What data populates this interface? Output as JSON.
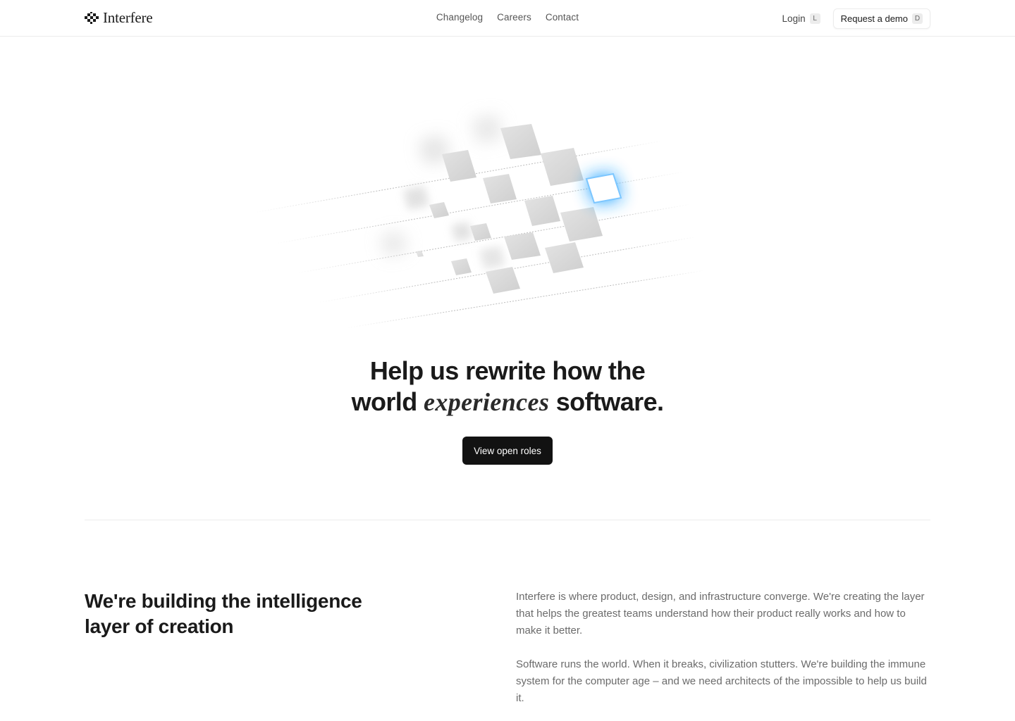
{
  "brand": {
    "name": "Interfere"
  },
  "nav": {
    "links": [
      "Changelog",
      "Careers",
      "Contact"
    ],
    "login_label": "Login",
    "login_key": "L",
    "demo_label": "Request a demo",
    "demo_key": "D"
  },
  "hero": {
    "title_line1": "Help us rewrite how the",
    "title_line2_before": "world",
    "title_accent": "experiences",
    "title_line2_after": "software.",
    "cta_label": "View open roles"
  },
  "about": {
    "title": "We're building the intelligence layer of creation",
    "paragraphs": [
      "Interfere is where product, design, and infrastructure converge. We're creating the layer that helps the greatest teams understand how their product really works and how to make it better.",
      "Software runs the world. When it breaks, civilization stutters. We're building the immune system for the computer age – and we need architects of the impossible to help us build it."
    ]
  },
  "colors": {
    "accent_glow": "#1ea0ff",
    "cta_background": "#121212",
    "divider": "#ececec"
  },
  "icons": {
    "brand_mark": "checker-logo-icon"
  }
}
